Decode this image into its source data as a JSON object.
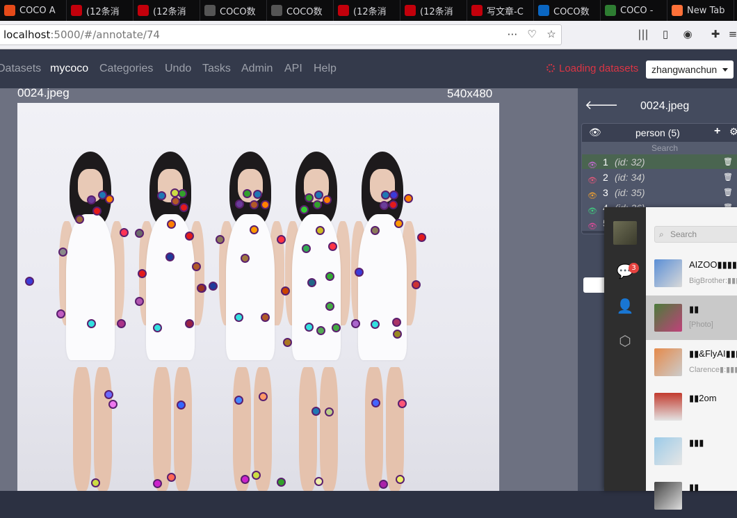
{
  "browser": {
    "tabs": [
      {
        "label": "COCO A",
        "icon": "coco-icon",
        "color": "#e64a19"
      },
      {
        "label": "(12条消",
        "icon": "csdn-icon",
        "color": "#c3000b"
      },
      {
        "label": "(12条消",
        "icon": "csdn-icon",
        "color": "#c3000b"
      },
      {
        "label": "COCO数",
        "icon": "github-icon",
        "color": "#555555"
      },
      {
        "label": "COCO数",
        "icon": "github-icon",
        "color": "#555555"
      },
      {
        "label": "(12条消",
        "icon": "csdn-icon",
        "color": "#c3000b"
      },
      {
        "label": "(12条消",
        "icon": "csdn-icon",
        "color": "#c3000b"
      },
      {
        "label": "写文章-C",
        "icon": "csdn-icon",
        "color": "#c3000b"
      },
      {
        "label": "COCO数",
        "icon": "zhihu-icon",
        "color": "#0a66c2"
      },
      {
        "label": "COCO -",
        "icon": "cocodataset-icon",
        "color": "#2e7d32"
      },
      {
        "label": "New Tab",
        "icon": "firefox-icon",
        "color": "#ff7139"
      }
    ],
    "url_host": "localhost",
    "url_rest": ":5000/#/annotate/74"
  },
  "app": {
    "menu": [
      "Datasets",
      "mycoco",
      "Categories",
      "Undo",
      "Tasks",
      "Admin",
      "API",
      "Help"
    ],
    "loading_text": "Loading datasets",
    "user": "zhangwanchun"
  },
  "image": {
    "filename": "0024.jpeg",
    "size": "540x480"
  },
  "panel": {
    "filename": "0024.jpeg",
    "category": "person (5)",
    "search_placeholder": "Search",
    "annotations": [
      {
        "num": "1",
        "id": "(id: 32)",
        "color": "#c86ad8",
        "bg": "#4a6550"
      },
      {
        "num": "2",
        "id": "(id: 34)",
        "color": "#e8587a",
        "bg": "#4f566a"
      },
      {
        "num": "3",
        "id": "(id: 35)",
        "color": "#f0a030",
        "bg": "#4f566a"
      },
      {
        "num": "4",
        "id": "(id: 36)",
        "color": "#40d080",
        "bg": "#4f566a"
      },
      {
        "num": "5",
        "id": "",
        "color": "#e04a9a",
        "bg": "#4f566a"
      }
    ]
  },
  "chat": {
    "badge": "3",
    "search_placeholder": "Search",
    "conversations": [
      {
        "title": "AIZOO▮▮▮▮▮",
        "subtitle": "BigBrother:▮▮▮▮",
        "selected": false
      },
      {
        "title": "▮▮",
        "subtitle": "[Photo]",
        "selected": true
      },
      {
        "title": "▮▮&FlyAI▮▮▮▮",
        "subtitle": "Clarence▮:▮▮▮▮",
        "selected": false
      },
      {
        "title": "▮▮2om",
        "subtitle": "",
        "selected": false
      },
      {
        "title": "▮▮▮",
        "subtitle": "",
        "selected": false
      },
      {
        "title": "▮▮",
        "subtitle": "",
        "selected": false
      }
    ]
  }
}
